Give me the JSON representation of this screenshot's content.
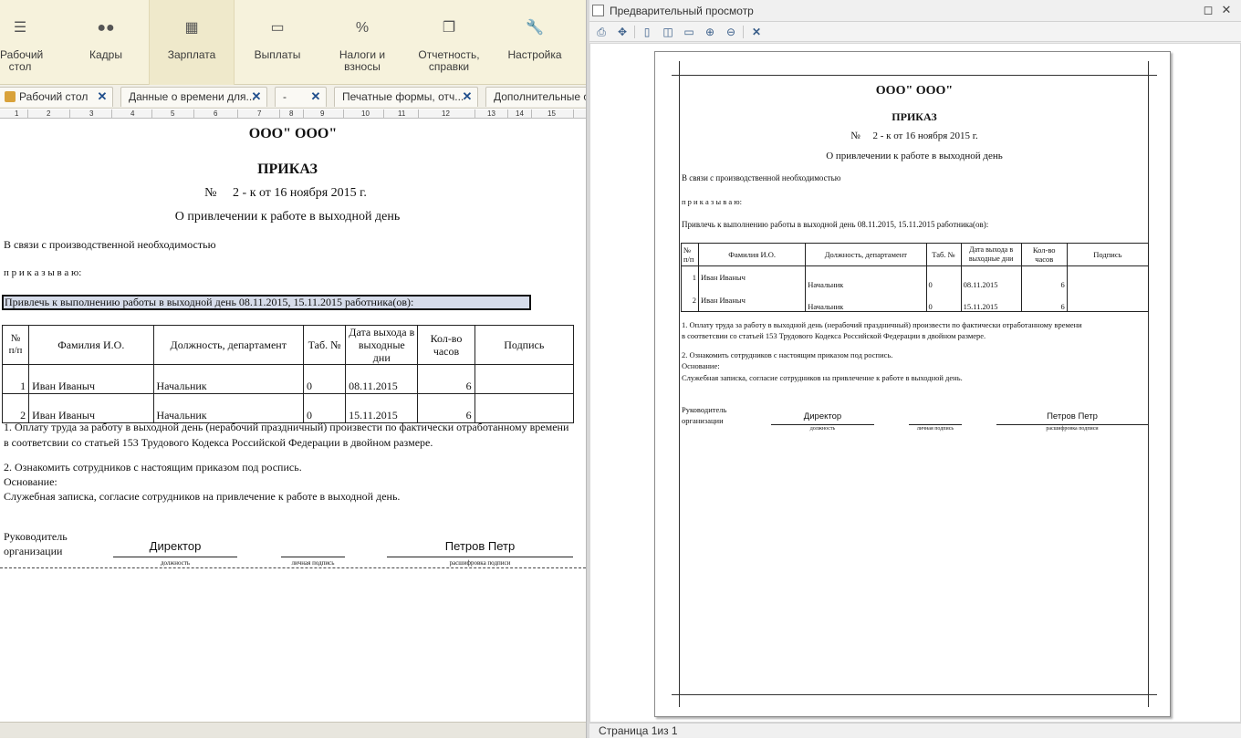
{
  "sections": [
    {
      "label": "Рабочий\nстол",
      "icon": "menu-icon"
    },
    {
      "label": "Кадры",
      "icon": "people-icon"
    },
    {
      "label": "Зарплата",
      "icon": "calculator-icon"
    },
    {
      "label": "Выплаты",
      "icon": "wallet-icon"
    },
    {
      "label": "Налоги и\nвзносы",
      "icon": "percent-icon"
    },
    {
      "label": "Отчетность,\nсправки",
      "icon": "reports-icon"
    },
    {
      "label": "Настройка",
      "icon": "wrench-icon"
    }
  ],
  "tabs": [
    "Рабочий стол",
    "Данные о времени для...",
    "-",
    "Печатные формы, отч...",
    "Дополнительные от"
  ],
  "ruler": [
    "1",
    "2",
    "3",
    "4",
    "5",
    "6",
    "7",
    "8",
    "9",
    "10",
    "11",
    "12",
    "13",
    "14",
    "15"
  ],
  "doc": {
    "org": "ООО\" ООО\"",
    "title": "ПРИКАЗ",
    "number": "№     2 - к от 16 ноября 2015 г.",
    "subject": "О привлечении к работе в выходной день",
    "reason": "В связи с производственной необходимостью",
    "order": "п р и к а з ы в а ю:",
    "engage": "Привлечь к выполнению работы в выходной день 08.11.2015, 15.11.2015 работника(ов):",
    "table_headers": [
      "№\nп/п",
      "Фамилия И.О.",
      "Должность, департамент",
      "Таб. №",
      "Дата выхода в выходные дни",
      "Кол-во часов",
      "Подпись"
    ],
    "table_rows": [
      [
        "1",
        "Иван Иваныч",
        "Начальник",
        "0",
        "08.11.2015",
        "6",
        ""
      ],
      [
        "2",
        "Иван Иваныч",
        "Начальник",
        "0",
        "15.11.2015",
        "6",
        ""
      ]
    ],
    "p1a": "1. Оплату труда за работу в выходной день (нерабочий праздничный) произвести по фактически отработанному времени",
    "p1b": "в соответсвии со статьей 153 Трудового Кодекса Российской Федерации в двойном размере.",
    "p2": "2. Ознакомить сотрудников с настоящим приказом под роспись.",
    "basis_label": "Основание:",
    "basis": "Служебная записка, согласие сотрудников на привлечение к работе в выходной день.",
    "head_label_1": "Руководитель",
    "head_label_2": "организации",
    "position": "Директор",
    "signer": "Петров Петр",
    "sig_caption_position": "должность",
    "sig_caption_signature": "личная подпись",
    "sig_caption_decoding": "расшифровка  подписи"
  },
  "preview": {
    "window_title": "Предварительный просмотр",
    "status": "Страница 1из 1"
  }
}
